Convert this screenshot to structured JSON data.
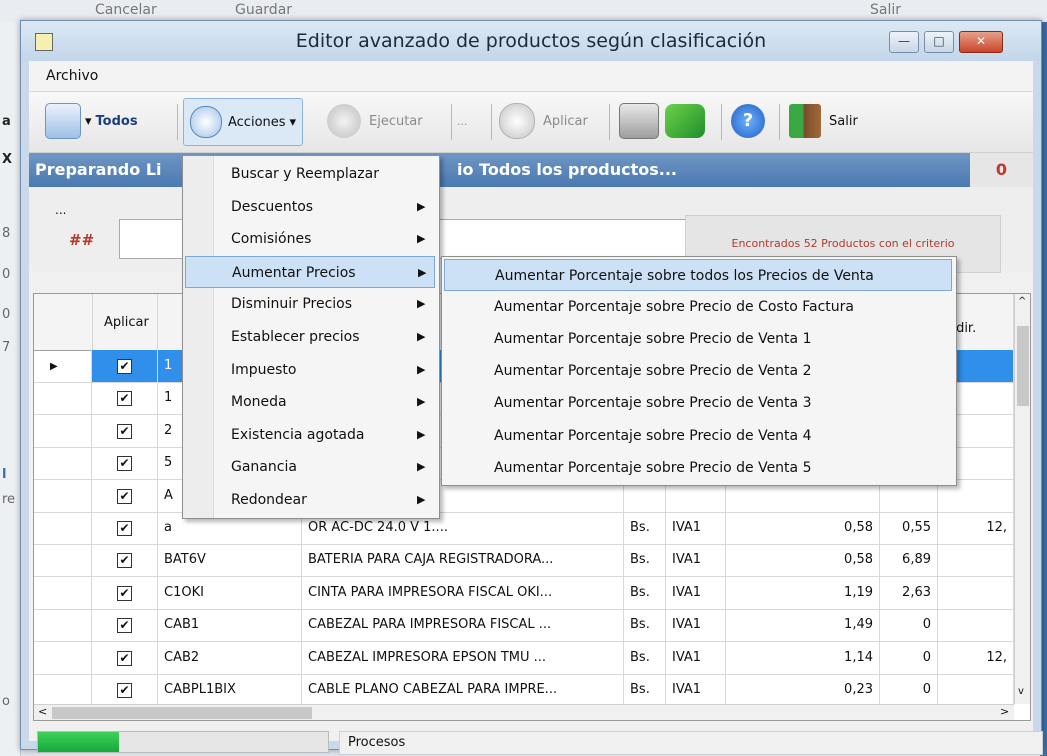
{
  "background": {
    "top_labels": [
      "Cancelar",
      "Guardar",
      "Salir"
    ],
    "left_letters": [
      "a",
      "X",
      "8",
      "0",
      "0",
      "7",
      "l",
      "re",
      "o"
    ]
  },
  "window": {
    "title": "Editor avanzado de productos según clasificación",
    "controls": {
      "minimize": "—",
      "maximize": "□",
      "close": "✕"
    }
  },
  "menubar": {
    "archivo": "Archivo"
  },
  "toolbar": {
    "todos": "Todos",
    "acciones": "Acciones",
    "ejecutar": "Ejecutar",
    "more": "...",
    "aplicar": "Aplicar",
    "salir": "Salir",
    "dropdown_arrow": "▾"
  },
  "banner": {
    "text_left": "Preparando Li",
    "text_right": "io Todos los productos...",
    "count": "0"
  },
  "criteria": {
    "dots": "...",
    "hash": "##",
    "found": "Encontrados 52 Productos con el criterio"
  },
  "grid": {
    "headers": {
      "aplicar": "Aplicar",
      "pct": "%",
      "indir": "Indir."
    },
    "row_marker": "▶",
    "check": "✔",
    "rows": [
      {
        "code": "1",
        "desc": "",
        "cur": "",
        "tax": "",
        "val": "",
        "val2": "",
        "val3": ""
      },
      {
        "code": "1",
        "desc": "",
        "cur": "",
        "tax": "",
        "val": "",
        "val2": "",
        "val3": ""
      },
      {
        "code": "2",
        "desc": "",
        "cur": "",
        "tax": "",
        "val": "",
        "val2": "",
        "val3": ""
      },
      {
        "code": "5",
        "desc": "",
        "cur": "",
        "tax": "",
        "val": "",
        "val2": "",
        "val3": ""
      },
      {
        "code": "A",
        "desc": "",
        "cur": "",
        "tax": "",
        "val": "",
        "val2": "",
        "val3": ""
      },
      {
        "code": "a",
        "desc": "OR AC-DC 24.0 V 1....",
        "cur": "Bs.",
        "tax": "IVA1",
        "val": "0,58",
        "val2": "0,55",
        "val3": "12,"
      },
      {
        "code": "BAT6V",
        "desc": "BATERIA PARA CAJA REGISTRADORA...",
        "cur": "Bs.",
        "tax": "IVA1",
        "val": "0,58",
        "val2": "6,89",
        "val3": ""
      },
      {
        "code": "C1OKI",
        "desc": "CINTA PARA IMPRESORA FISCAL OKI...",
        "cur": "Bs.",
        "tax": "IVA1",
        "val": "1,19",
        "val2": "2,63",
        "val3": ""
      },
      {
        "code": "CAB1",
        "desc": "CABEZAL PARA IMPRESORA FISCAL ...",
        "cur": "Bs.",
        "tax": "IVA1",
        "val": "1,49",
        "val2": "0",
        "val3": ""
      },
      {
        "code": "CAB2",
        "desc": "CABEZAL IMPRESORA EPSON TMU ...",
        "cur": "Bs.",
        "tax": "IVA1",
        "val": "1,14",
        "val2": "0",
        "val3": "12,"
      },
      {
        "code": "CABPL1BIX",
        "desc": "CABLE PLANO CABEZAL PARA IMPRE...",
        "cur": "Bs.",
        "tax": "IVA1",
        "val": "0,23",
        "val2": "0",
        "val3": ""
      }
    ],
    "scroll": {
      "up": "^",
      "down": "v",
      "left": "<",
      "right": ">"
    }
  },
  "status": {
    "procesos": "Procesos",
    "progress_fraction": 0.28
  },
  "menus": {
    "acciones": [
      {
        "label": "Buscar y Reemplazar",
        "has_sub": false
      },
      {
        "label": "Descuentos",
        "has_sub": true
      },
      {
        "label": "Comisiónes",
        "has_sub": true
      },
      {
        "label": "Aumentar Precios",
        "has_sub": true,
        "highlighted": true
      },
      {
        "label": "Disminuir Precios",
        "has_sub": true
      },
      {
        "label": "Establecer precios",
        "has_sub": true
      },
      {
        "label": "Impuesto",
        "has_sub": true
      },
      {
        "label": "Moneda",
        "has_sub": true
      },
      {
        "label": "Existencia agotada",
        "has_sub": true
      },
      {
        "label": "Ganancia",
        "has_sub": true
      },
      {
        "label": "Redondear",
        "has_sub": true
      }
    ],
    "aumentar_precios": [
      {
        "label": "Aumentar Porcentaje sobre todos los Precios de Venta",
        "highlighted": true
      },
      {
        "label": "Aumentar Porcentaje sobre Precio de Costo Factura"
      },
      {
        "label": "Aumentar Porcentaje sobre Precio de Venta 1"
      },
      {
        "label": "Aumentar Porcentaje sobre Precio de Venta 2"
      },
      {
        "label": "Aumentar Porcentaje sobre Precio de Venta 3"
      },
      {
        "label": "Aumentar Porcentaje sobre Precio de Venta 4"
      },
      {
        "label": "Aumentar Porcentaje sobre Precio de Venta 5"
      }
    ],
    "submenu_arrow": "▶"
  },
  "colors": {
    "banner": "#4c79b0",
    "highlight": "#cde1f6",
    "progress": "#16a83a",
    "red_text": "#b03a2e",
    "selected_row": "#2f8fea"
  }
}
